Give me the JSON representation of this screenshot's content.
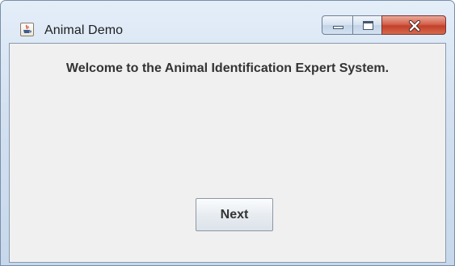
{
  "window": {
    "title": "Animal Demo",
    "app_icon": "java-cup-icon",
    "caption_buttons": [
      "minimize-icon",
      "maximize-icon",
      "close-icon"
    ]
  },
  "content": {
    "welcome_text": "Welcome to the Animal Identification Expert System.",
    "next_label": "Next"
  },
  "colors": {
    "content_background": "#f0f0f0",
    "text": "#333333",
    "close_button": "#c9452f",
    "title_bar": "#d3e1f1"
  }
}
